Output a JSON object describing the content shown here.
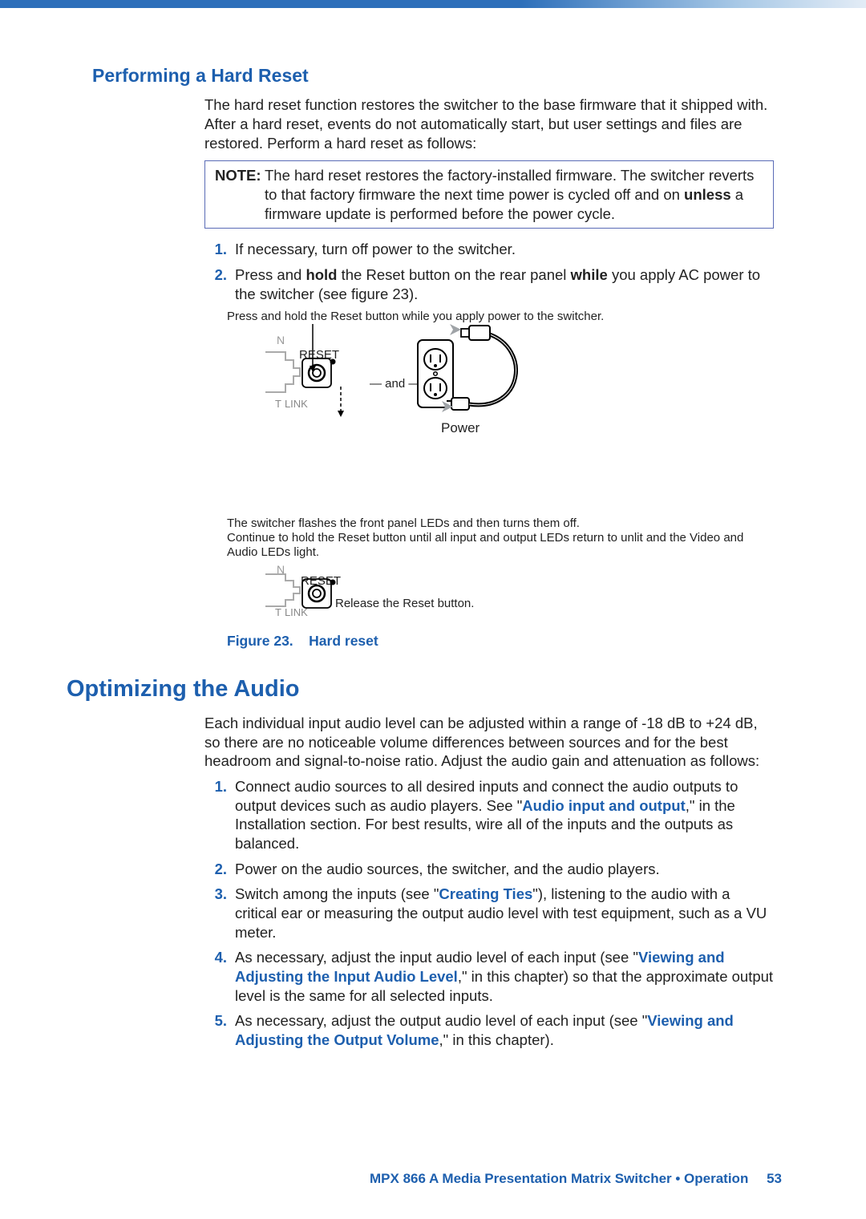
{
  "section1": {
    "title": "Performing a Hard Reset",
    "intro": "The hard reset function restores the switcher to the base firmware that it shipped with. After a hard reset, events do not automatically start, but user settings and files are restored. Perform a hard reset as follows:",
    "note_label": "NOTE:",
    "note_text_1": "The hard reset restores the factory-installed firmware. The switcher reverts to that factory firmware the next time power is cycled off and on ",
    "note_text_bold": "unless",
    "note_text_2": " a firmware update is performed before the power cycle.",
    "steps": {
      "1": "If necessary, turn off power to the switcher.",
      "2a": "Press and ",
      "2b": "hold",
      "2c": " the Reset button on the rear panel ",
      "2d": "while",
      "2e": " you apply AC power to the switcher (see figure 23)."
    },
    "fig_instr_top": "Press and hold the Reset button while you apply power to the switcher.",
    "fig_reset": "RESET",
    "fig_link": "LINK",
    "fig_n": "N",
    "fig_t": "T",
    "fig_and": "— and —",
    "fig_power": "Power",
    "fig_instr_mid": "The switcher flashes the front panel LEDs and then turns them off.\nContinue to hold the Reset button until all input and output LEDs return to unlit and the Video and Audio LEDs light.",
    "fig_release": "Release the Reset button.",
    "fig_caption_label": "Figure 23.",
    "fig_caption_text": "Hard reset"
  },
  "section2": {
    "title": "Optimizing the Audio",
    "intro": "Each individual input audio level can be adjusted within a range of -18 dB to +24 dB, so there are no noticeable volume differences between sources and for the best headroom and signal-to-noise ratio. Adjust the audio gain and attenuation as follows:",
    "steps": {
      "1a": "Connect audio sources to all desired inputs and connect the audio outputs to output devices such as audio players. See \"",
      "1link": "Audio input and output",
      "1b": ",\" in the Installation section. For best results, wire all of the inputs and the outputs as balanced.",
      "2": "Power on the audio sources, the switcher, and the audio players.",
      "3a": "Switch among the inputs (see \"",
      "3link": "Creating Ties",
      "3b": "\"), listening to the audio with a critical ear or measuring the output audio level with test equipment, such as a VU meter.",
      "4a": "As necessary, adjust the input audio level of each input (see \"",
      "4link": "Viewing and Adjusting the Input Audio Level",
      "4b": ",\" in this chapter) so that the approximate output level is the same for all selected inputs.",
      "5a": "As necessary, adjust the output audio level of each input (see \"",
      "5link": "Viewing and Adjusting the Output Volume",
      "5b": ",\" in this chapter)."
    }
  },
  "footer": {
    "text": "MPX 866 A Media Presentation Matrix Switcher • Operation",
    "page": "53"
  }
}
